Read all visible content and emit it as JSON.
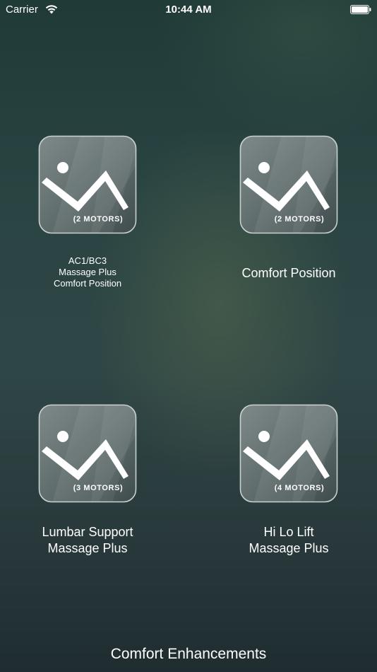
{
  "status_bar": {
    "carrier": "Carrier",
    "time": "10:44 AM",
    "wifi_icon": "wifi-icon",
    "battery_icon": "battery-icon"
  },
  "tiles": [
    {
      "motors": "(2 MOTORS)",
      "caption_lines": [
        "AC1/BC3",
        "Massage Plus",
        "Comfort Position"
      ]
    },
    {
      "motors": "(2 MOTORS)",
      "caption_lines": [
        "Comfort Position"
      ]
    },
    {
      "motors": "(3 MOTORS)",
      "caption_lines": [
        "Lumbar Support",
        "Massage Plus"
      ]
    },
    {
      "motors": "(4 MOTORS)",
      "caption_lines": [
        "Hi Lo Lift",
        "Massage Plus"
      ]
    }
  ],
  "tile_icon": "reclining-bed-icon",
  "footer": {
    "label": "Comfort Enhancements"
  },
  "colors": {
    "background_top": "#1f3a37",
    "background_bottom": "#1f2d31",
    "tile_fill": "#5e6b6b",
    "tile_border": "#c9d2d0",
    "text": "#ffffff"
  }
}
